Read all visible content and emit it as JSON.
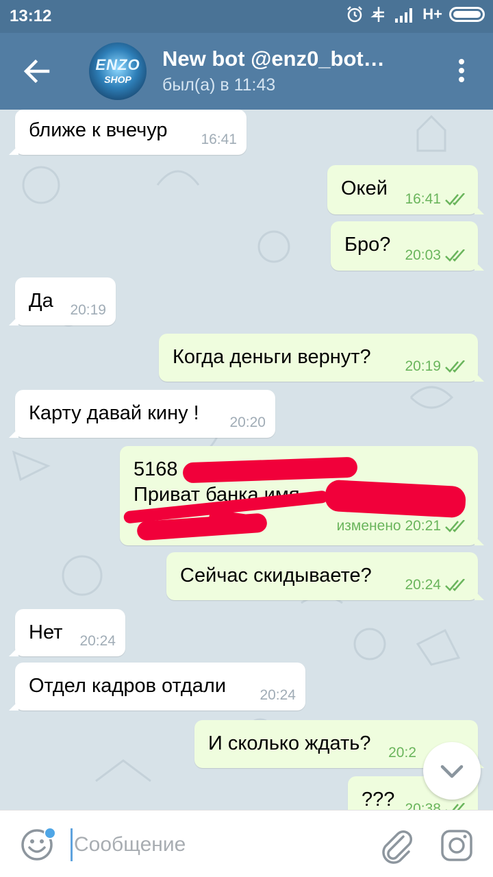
{
  "status_bar": {
    "time": "13:12",
    "network": "H+"
  },
  "header": {
    "chat_name": "New bot @enz0_bot…",
    "status": "был(а) в 11:43",
    "avatar_text": "ENZO",
    "avatar_sub": "SHOP"
  },
  "messages": [
    {
      "dir": "in",
      "text": "ближе к вчечур",
      "time": "16:41"
    },
    {
      "dir": "out",
      "text": "Окей",
      "time": "16:41"
    },
    {
      "dir": "out",
      "text": "Бро?",
      "time": "20:03"
    },
    {
      "dir": "in",
      "text": "Да",
      "time": "20:19"
    },
    {
      "dir": "out",
      "text": "Когда деньги вернут?",
      "time": "20:19"
    },
    {
      "dir": "in",
      "text": "Карту давай кину !",
      "time": "20:20"
    },
    {
      "dir": "out",
      "text_line1": "5168",
      "text_line2": "Приват банка имя",
      "time": "изменено 20:21"
    },
    {
      "dir": "out",
      "text": "Сейчас скидываете?",
      "time": "20:24"
    },
    {
      "dir": "in",
      "text": "Нет",
      "time": "20:24"
    },
    {
      "dir": "in",
      "text": "Отдел кадров отдали",
      "time": "20:24"
    },
    {
      "dir": "out",
      "text": "И сколько ждать?",
      "time": "20:2"
    },
    {
      "dir": "out",
      "text": "???",
      "time": "20:38"
    }
  ],
  "input": {
    "placeholder": "Сообщение"
  },
  "colors": {
    "header": "#527da3",
    "statusbar": "#4a7396",
    "outgoing_bubble": "#effdde",
    "incoming_bubble": "#ffffff",
    "accent": "#4fa6e6",
    "redaction": "#f1003a"
  }
}
